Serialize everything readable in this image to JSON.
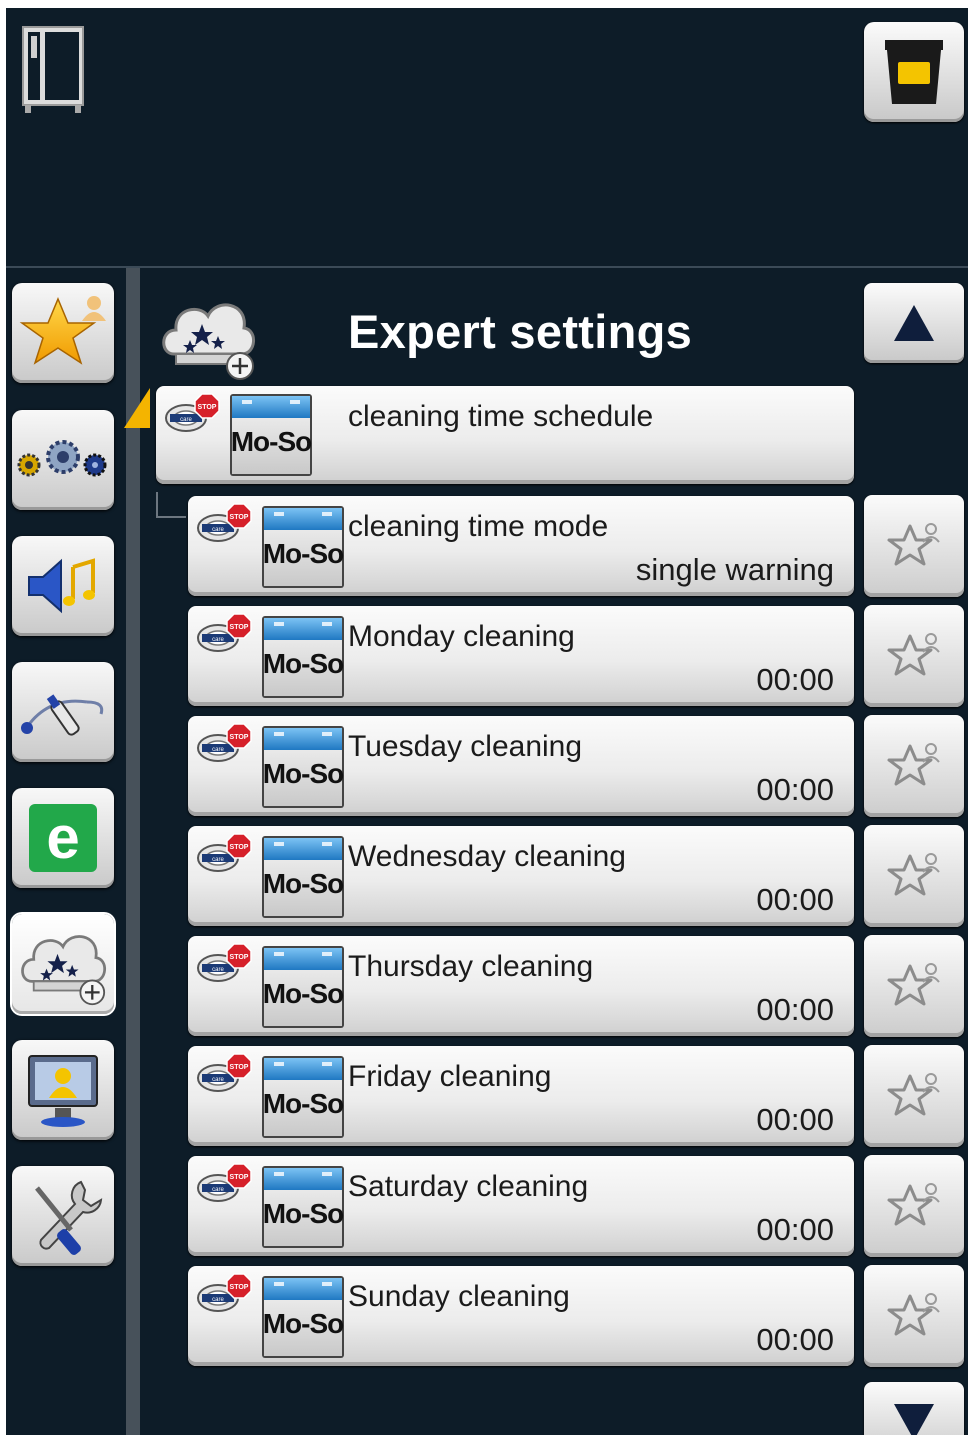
{
  "header": {
    "oven_icon": "combi-oven-icon",
    "cup_button_icon": "cup-icon"
  },
  "sidebar": {
    "items": [
      {
        "icon": "favorites-star-user-icon"
      },
      {
        "icon": "gears-icon"
      },
      {
        "icon": "speaker-music-icon"
      },
      {
        "icon": "probe-tool-icon"
      },
      {
        "icon": "efficiency-e-icon"
      },
      {
        "icon": "expert-settings-cloud-stars-icon",
        "active": true
      },
      {
        "icon": "user-monitor-icon"
      },
      {
        "icon": "service-tools-icon"
      }
    ]
  },
  "main": {
    "title": "Expert settings",
    "title_icon": "expert-settings-cloud-stars-icon",
    "scroll_up_icon": "arrow-up-icon",
    "scroll_down_icon": "arrow-down-icon",
    "calendar_label": "Mo-So",
    "parent_row": {
      "label": "cleaning time schedule"
    },
    "rows": [
      {
        "label": "cleaning time mode",
        "value": "single warning"
      },
      {
        "label": "Monday cleaning",
        "value": "00:00"
      },
      {
        "label": "Tuesday cleaning",
        "value": "00:00"
      },
      {
        "label": "Wednesday cleaning",
        "value": "00:00"
      },
      {
        "label": "Thursday cleaning",
        "value": "00:00"
      },
      {
        "label": "Friday cleaning",
        "value": "00:00"
      },
      {
        "label": "Saturday cleaning",
        "value": "00:00"
      },
      {
        "label": "Sunday cleaning",
        "value": "00:00"
      }
    ]
  },
  "colors": {
    "background": "#0d1c28",
    "accent_yellow": "#f4c400",
    "calendar_blue": "#2f8fd6",
    "stop_red": "#d6202a"
  }
}
